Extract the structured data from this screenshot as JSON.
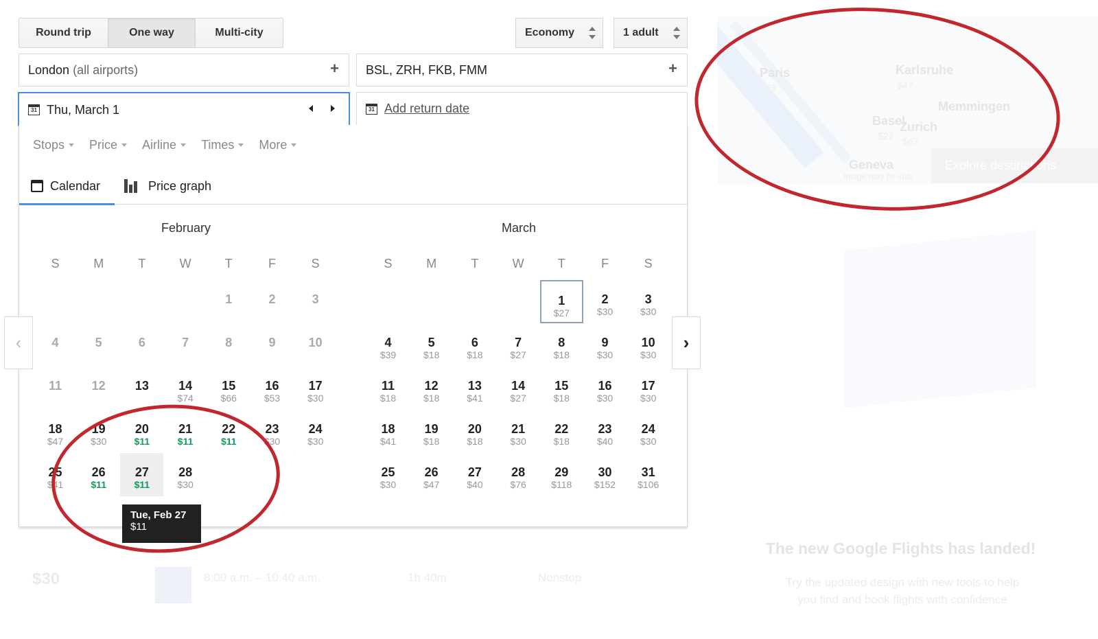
{
  "trip_types": [
    "Round trip",
    "One way",
    "Multi-city"
  ],
  "active_trip_type": 1,
  "cabin": "Economy",
  "passengers": "1 adult",
  "origin": {
    "city": "London",
    "suffix": "(all airports)"
  },
  "destination": "BSL, ZRH, FKB, FMM",
  "depart_date": "Thu, March 1",
  "return_placeholder": "Add return date",
  "date_icon": "31",
  "filters": [
    "Stops",
    "Price",
    "Airline",
    "Times",
    "More"
  ],
  "tabs": [
    "Calendar",
    "Price graph"
  ],
  "weekdays": [
    "S",
    "M",
    "T",
    "W",
    "T",
    "F",
    "S"
  ],
  "colors": {
    "cheap": "#0f9d58",
    "tab_accent": "#4a90e2",
    "annotation_red": "#c1272d"
  },
  "months": [
    {
      "name": "February",
      "rows": [
        [
          null,
          null,
          null,
          null,
          {
            "d": "1",
            "p": "",
            "dis": true
          },
          {
            "d": "2",
            "p": "",
            "dis": true
          },
          {
            "d": "3",
            "p": "",
            "dis": true
          }
        ],
        [
          {
            "d": "4",
            "p": "",
            "dis": true
          },
          {
            "d": "5",
            "p": "",
            "dis": true
          },
          {
            "d": "6",
            "p": "",
            "dis": true
          },
          {
            "d": "7",
            "p": "",
            "dis": true
          },
          {
            "d": "8",
            "p": "",
            "dis": true
          },
          {
            "d": "9",
            "p": "",
            "dis": true
          },
          {
            "d": "10",
            "p": "",
            "dis": true
          }
        ],
        [
          {
            "d": "11",
            "p": "",
            "dis": true
          },
          {
            "d": "12",
            "p": "",
            "dis": true
          },
          {
            "d": "13",
            "p": ""
          },
          {
            "d": "14",
            "p": "$74"
          },
          {
            "d": "15",
            "p": "$66"
          },
          {
            "d": "16",
            "p": "$53"
          },
          {
            "d": "17",
            "p": "$30"
          }
        ],
        [
          {
            "d": "18",
            "p": "$47"
          },
          {
            "d": "19",
            "p": "$30"
          },
          {
            "d": "20",
            "p": "$11",
            "cheap": true
          },
          {
            "d": "21",
            "p": "$11",
            "cheap": true
          },
          {
            "d": "22",
            "p": "$11",
            "cheap": true
          },
          {
            "d": "23",
            "p": "$30"
          },
          {
            "d": "24",
            "p": "$30"
          }
        ],
        [
          {
            "d": "25",
            "p": "$41"
          },
          {
            "d": "26",
            "p": "$11",
            "cheap": true
          },
          {
            "d": "27",
            "p": "$11",
            "cheap": true,
            "hover": true
          },
          {
            "d": "28",
            "p": "$30"
          },
          null,
          null,
          null
        ]
      ]
    },
    {
      "name": "March",
      "rows": [
        [
          null,
          null,
          null,
          null,
          {
            "d": "1",
            "p": "$27",
            "sel": true
          },
          {
            "d": "2",
            "p": "$30"
          },
          {
            "d": "3",
            "p": "$30"
          }
        ],
        [
          {
            "d": "4",
            "p": "$39"
          },
          {
            "d": "5",
            "p": "$18"
          },
          {
            "d": "6",
            "p": "$18"
          },
          {
            "d": "7",
            "p": "$27"
          },
          {
            "d": "8",
            "p": "$18"
          },
          {
            "d": "9",
            "p": "$30"
          },
          {
            "d": "10",
            "p": "$30"
          }
        ],
        [
          {
            "d": "11",
            "p": "$18"
          },
          {
            "d": "12",
            "p": "$18"
          },
          {
            "d": "13",
            "p": "$41"
          },
          {
            "d": "14",
            "p": "$27"
          },
          {
            "d": "15",
            "p": "$18"
          },
          {
            "d": "16",
            "p": "$30"
          },
          {
            "d": "17",
            "p": "$30"
          }
        ],
        [
          {
            "d": "18",
            "p": "$41"
          },
          {
            "d": "19",
            "p": "$18"
          },
          {
            "d": "20",
            "p": "$18"
          },
          {
            "d": "21",
            "p": "$30"
          },
          {
            "d": "22",
            "p": "$18"
          },
          {
            "d": "23",
            "p": "$40"
          },
          {
            "d": "24",
            "p": "$30"
          }
        ],
        [
          {
            "d": "25",
            "p": "$30"
          },
          {
            "d": "26",
            "p": "$47"
          },
          {
            "d": "27",
            "p": "$40"
          },
          {
            "d": "28",
            "p": "$76"
          },
          {
            "d": "29",
            "p": "$118"
          },
          {
            "d": "30",
            "p": "$152"
          },
          {
            "d": "31",
            "p": "$106"
          }
        ]
      ]
    }
  ],
  "tooltip": {
    "date": "Tue, Feb 27",
    "price": "$11"
  },
  "map": {
    "cities": [
      {
        "name": "Paris",
        "price": "$63"
      },
      {
        "name": "Karlsruhe",
        "price": "$47"
      },
      {
        "name": "Memmingen",
        "price": ""
      },
      {
        "name": "Basel",
        "price": "$27"
      },
      {
        "name": "Zurich",
        "price": "$67"
      },
      {
        "name": "Geneva",
        "price": ""
      }
    ],
    "explore_label": "Explore destinations",
    "disclaimer": "Image may be subj"
  },
  "result": {
    "price": "$30",
    "times": "8:00 a.m. – 10:40 a.m.",
    "duration": "1h 40m",
    "stops": "Nonstop"
  },
  "promo": {
    "title": "The new Google Flights has landed!",
    "body": "Try the updated design with new tools to help you find and book flights with confidence"
  }
}
